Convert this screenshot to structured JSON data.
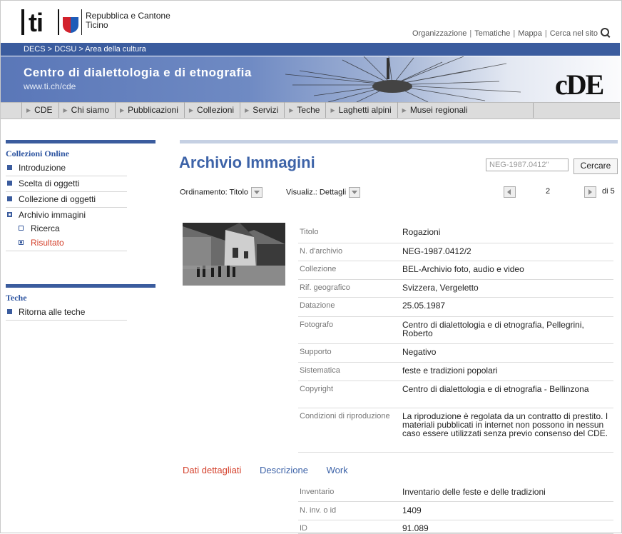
{
  "header": {
    "logo_text": "ti",
    "org_name": "Repubblica e Cantone Ticino",
    "top_links": [
      "Organizzazione",
      "Tematiche",
      "Mappa",
      "Cerca nel sito"
    ],
    "breadcrumb": "DECS > DCSU > Area della cultura",
    "banner_title": "Centro di dialettologia e di etnografia",
    "banner_url": "www.ti.ch/cde",
    "banner_logo": "cDE"
  },
  "nav": [
    "CDE",
    "Chi siamo",
    "Pubblicazioni",
    "Collezioni",
    "Servizi",
    "Teche",
    "Laghetti alpini",
    "Musei regionali"
  ],
  "sidebar": {
    "section1_title": "Collezioni Online",
    "section1_items": [
      "Introduzione",
      "Scelta di oggetti",
      "Collezione di oggetti",
      "Archivio immagini"
    ],
    "sub_items": [
      "Ricerca",
      "Risultato"
    ],
    "section2_title": "Teche",
    "section2_items": [
      "Ritorna alle teche"
    ]
  },
  "main": {
    "title": "Archivio Immagini",
    "search_value": "NEG-1987.0412\"",
    "search_button": "Cercare",
    "sort_label": "Ordinamento:",
    "sort_value": "Titolo",
    "view_label": "Visualiz.:",
    "view_value": "Dettagli",
    "page_current": "2",
    "page_total": "di 5",
    "details": [
      {
        "k": "Titolo",
        "v": "Rogazioni"
      },
      {
        "k": "N. d'archivio",
        "v": "NEG-1987.0412/2"
      },
      {
        "k": "Collezione",
        "v": "BEL-Archivio foto, audio e video"
      },
      {
        "k": "Rif. geografico",
        "v": "Svizzera, Vergeletto"
      },
      {
        "k": "Datazione",
        "v": "25.05.1987"
      },
      {
        "k": "Fotografo",
        "v": "Centro di dialettologia e di etnografia, Pellegrini, Roberto"
      },
      {
        "k": "Supporto",
        "v": "Negativo"
      },
      {
        "k": "Sistematica",
        "v": "feste e tradizioni popolari"
      },
      {
        "k": "Copyright",
        "v": "Centro di dialettologia e di etnografia - Bellinzona"
      },
      {
        "k": "Condizioni di riproduzione",
        "v": "La riproduzione è regolata da un contratto di prestito. I materiali pubblicati in internet non possono in nessun caso essere utilizzati senza previo consenso del CDE."
      }
    ],
    "tabs": [
      "Dati dettagliati",
      "Descrizione",
      "Work"
    ],
    "extra": [
      {
        "k": "Inventario",
        "v": "Inventario delle feste e delle tradizioni"
      },
      {
        "k": "N. inv. o id",
        "v": "1409"
      },
      {
        "k": "ID",
        "v": "91.089"
      }
    ]
  },
  "colors": {
    "accent": "#3b5c9e",
    "title": "#3d63a8",
    "active": "#d4402b"
  }
}
